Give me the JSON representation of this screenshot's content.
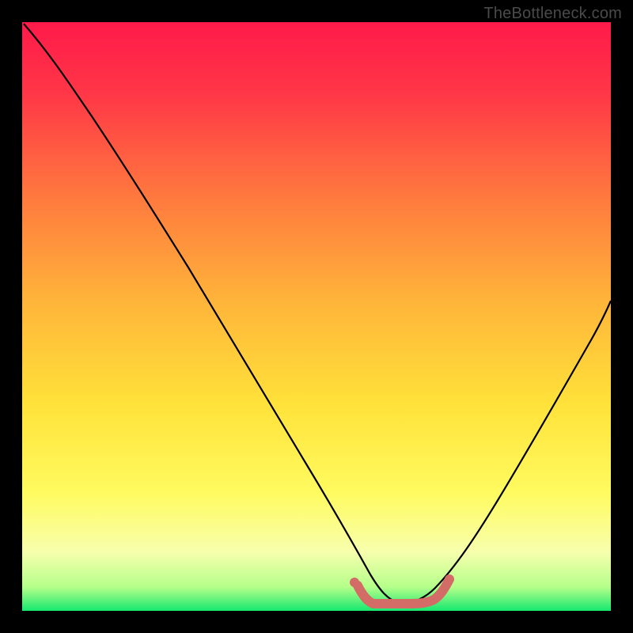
{
  "watermark": "TheBottleneck.com",
  "chart_data": {
    "type": "line",
    "title": "",
    "xlabel": "",
    "ylabel": "",
    "xlim": [
      0,
      100
    ],
    "ylim": [
      0,
      100
    ],
    "background": {
      "type": "vertical_gradient",
      "stops": [
        {
          "offset": 0,
          "color": "#ff1744"
        },
        {
          "offset": 50,
          "color": "#ffd740"
        },
        {
          "offset": 85,
          "color": "#ffff8d"
        },
        {
          "offset": 100,
          "color": "#00e676"
        }
      ]
    },
    "series": [
      {
        "name": "bottleneck_curve",
        "color": "#000000",
        "x": [
          0,
          6,
          12,
          18,
          24,
          30,
          36,
          42,
          48,
          52,
          55,
          58,
          62,
          66,
          70,
          76,
          82,
          88,
          94,
          100
        ],
        "y": [
          100,
          90,
          80,
          70,
          59,
          48,
          37,
          26,
          15,
          7,
          3,
          1,
          0,
          0,
          2,
          8,
          18,
          30,
          43,
          57
        ]
      },
      {
        "name": "optimal_range_marker",
        "color": "#d36b66",
        "x": [
          54,
          58,
          62,
          66,
          70
        ],
        "y": [
          2,
          0.5,
          0,
          0,
          2
        ]
      }
    ]
  }
}
